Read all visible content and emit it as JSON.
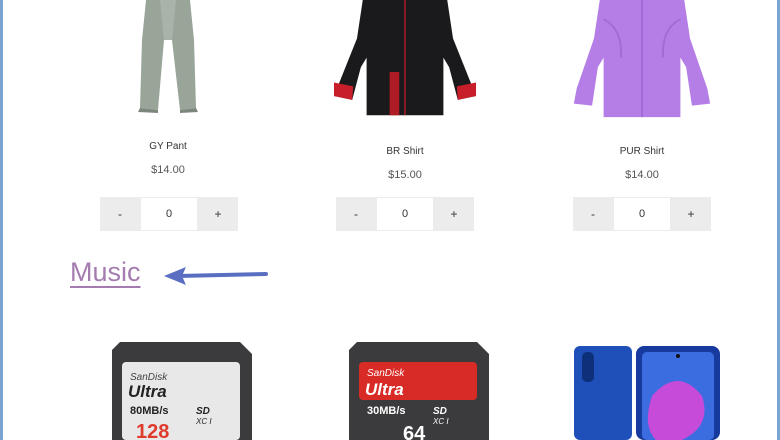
{
  "products_top": [
    {
      "name": "GY Pant",
      "price": "$14.00",
      "qty": "0",
      "minus": "-",
      "plus": "+"
    },
    {
      "name": "BR Shirt",
      "price": "$15.00",
      "qty": "0",
      "minus": "-",
      "plus": "+"
    },
    {
      "name": "PUR Shirt",
      "price": "$14.00",
      "qty": "0",
      "minus": "-",
      "plus": "+"
    }
  ],
  "section": {
    "title": "Music"
  },
  "products_bottom": [
    {
      "brand": "SanDisk",
      "line": "Ultra",
      "speed": "80MB/s",
      "capacity": "128"
    },
    {
      "brand": "SanDisk",
      "line": "Ultra",
      "speed": "30MB/s",
      "capacity": "64"
    },
    {
      "brand": "",
      "line": "",
      "speed": "",
      "capacity": ""
    }
  ],
  "colors": {
    "accent": "#a47cb0",
    "arrow": "#5a6fc2",
    "frame": "#7aa5d2",
    "stepper_bg": "#ececec"
  }
}
